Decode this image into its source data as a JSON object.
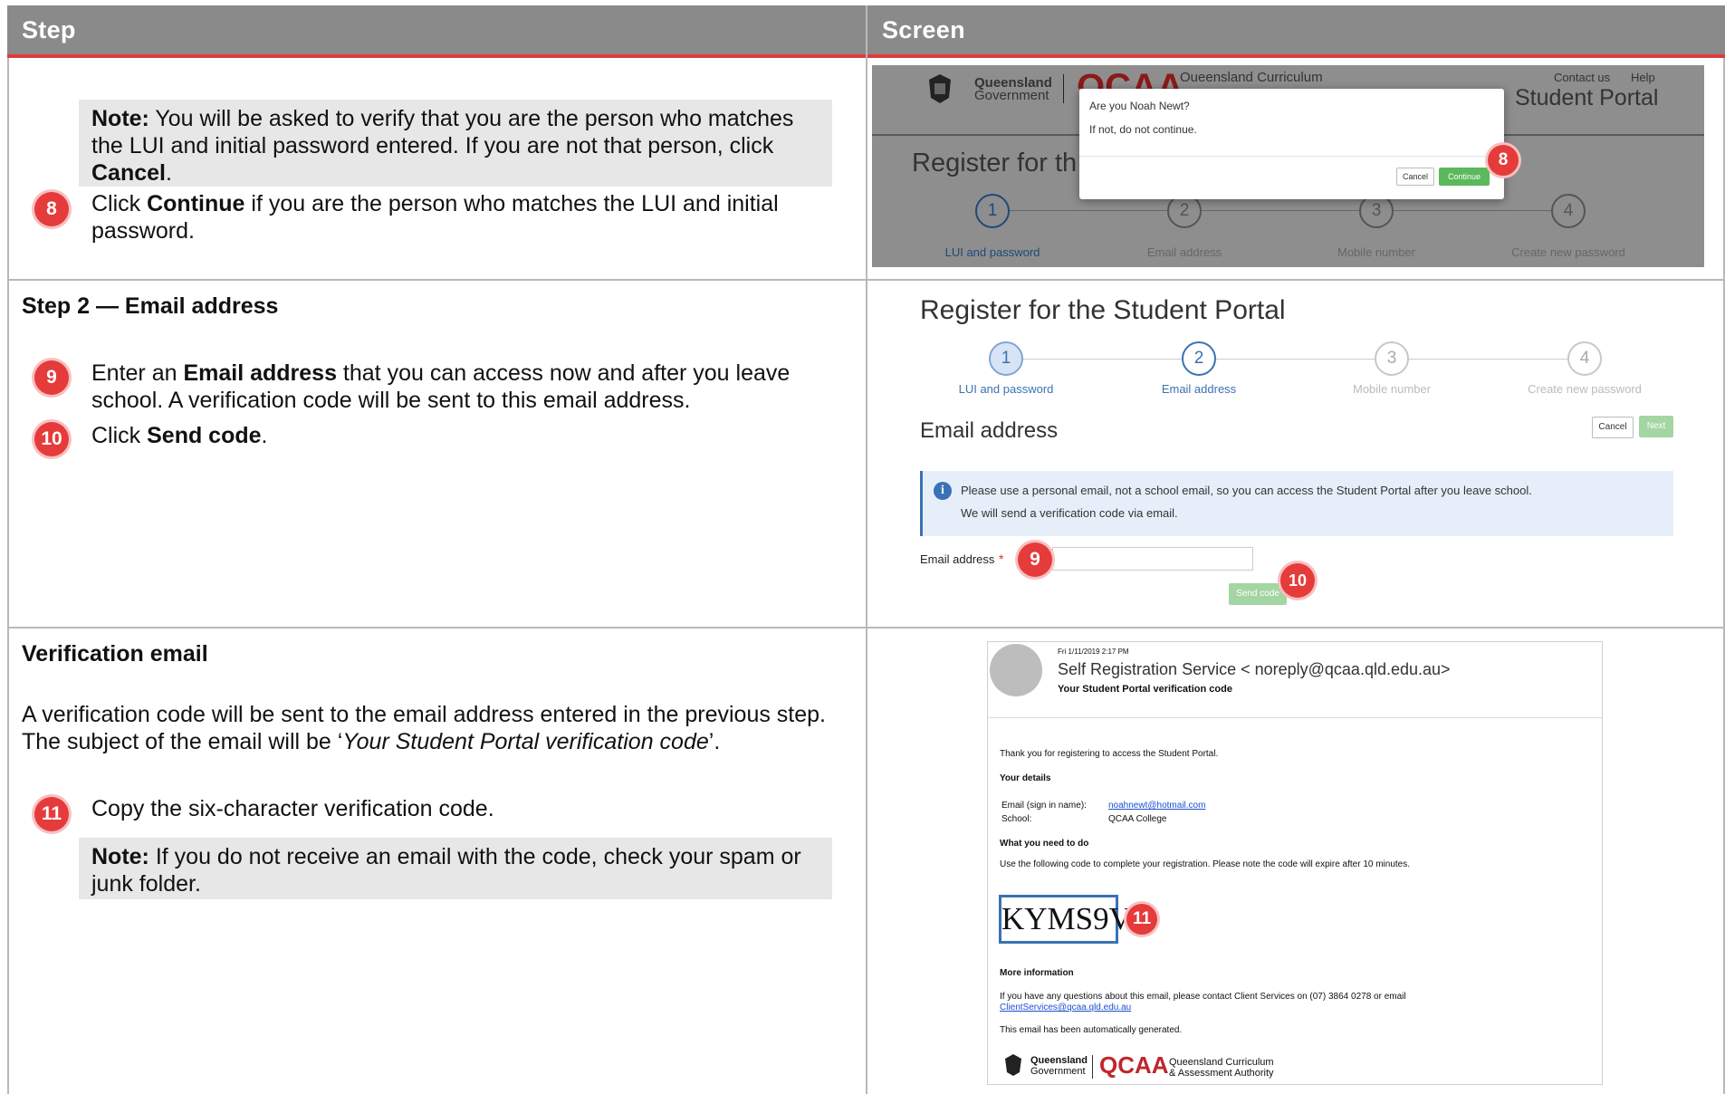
{
  "table": {
    "col_step": "Step",
    "col_screen": "Screen"
  },
  "row1": {
    "note_label": "Note:",
    "note_text_a": " You will be asked to verify that you are the person who matches the LUI and initial password entered. If you are not that person, click ",
    "note_cancel": "Cancel",
    "note_text_b": ".",
    "step8_num": "8",
    "step8_a": "Click ",
    "step8_bold": "Continue",
    "step8_b": " if you are the person who matches the LUI and initial password."
  },
  "shot1": {
    "gov_line1": "Queensland",
    "gov_line2": "Government",
    "qcaa_partial": "QCAA",
    "qc_partial": "Queensland Curriculum",
    "contact": "Contact us",
    "help": "Help",
    "portal": "Student Portal",
    "register_partial": "Register for th",
    "modal_q": "Are you Noah Newt?",
    "modal_sub": "If not, do not continue.",
    "cancel": "Cancel",
    "continue": "Continue",
    "badge": "8",
    "steps": [
      {
        "num": "1",
        "label": "LUI and password"
      },
      {
        "num": "2",
        "label": "Email address"
      },
      {
        "num": "3",
        "label": "Mobile number"
      },
      {
        "num": "4",
        "label": "Create new password"
      }
    ]
  },
  "row2": {
    "heading": "Step 2 — Email address",
    "step9_num": "9",
    "step9_a": "Enter an ",
    "step9_bold": "Email address",
    "step9_b": " that you can access now and after you leave school. A verification code will be sent to this email address.",
    "step10_num": "10",
    "step10_a": "Click ",
    "step10_bold": "Send code",
    "step10_b": "."
  },
  "shot2": {
    "title": "Register for the Student Portal",
    "steps": [
      {
        "num": "1",
        "label": "LUI and password"
      },
      {
        "num": "2",
        "label": "Email address"
      },
      {
        "num": "3",
        "label": "Mobile number"
      },
      {
        "num": "4",
        "label": "Create new password"
      }
    ],
    "section": "Email address",
    "cancel": "Cancel",
    "next": "Next",
    "info_line1": "Please use a personal email, not a school email, so you can access the Student Portal after you leave school.",
    "info_line2": "We will send a verification code via email.",
    "field_label": "Email address",
    "required": "*",
    "send_code": "Send code",
    "badge9": "9",
    "badge10": "10"
  },
  "row3": {
    "heading": "Verification email",
    "para_a": "A verification code will be sent to the email address entered in the previous step. The subject of the email will be ‘",
    "para_italic": "Your Student Portal verification code",
    "para_b": "’.",
    "step11_num": "11",
    "step11_text": "Copy the six-character verification code.",
    "note_label": "Note:",
    "note_text": " If you do not receive an email with the code, check your spam or junk folder."
  },
  "shot3": {
    "date": "Fri 1/11/2019 2:17 PM",
    "from": "Self Registration Service < noreply@qcaa.qld.edu.au>",
    "subject": "Your Student Portal verification code",
    "thanks": "Thank you for registering to access the Student Portal.",
    "your_details": "Your details",
    "email_label": "Email (sign in name):",
    "email_value": "noahnewt@hotmail.com",
    "school_label": "School:",
    "school_value": "QCAA College",
    "what_to_do": "What you need to do",
    "instructions": "Use the following code to complete your registration. Please note the code will expire after 10 minutes.",
    "code": "KYMS9V",
    "badge": "11",
    "more_info": "More information",
    "more_text": "If you have any questions about this email, please contact Client Services on (07) 3864 0278 or email",
    "more_link": "ClientServices@qcaa.qld.edu.au",
    "auto": "This email has been automatically generated.",
    "foot_gov1": "Queensland",
    "foot_gov2": "Government",
    "foot_qcaa": "QCAA",
    "foot_auth1": "Queensland Curriculum",
    "foot_auth2": "& Assessment Authority"
  }
}
